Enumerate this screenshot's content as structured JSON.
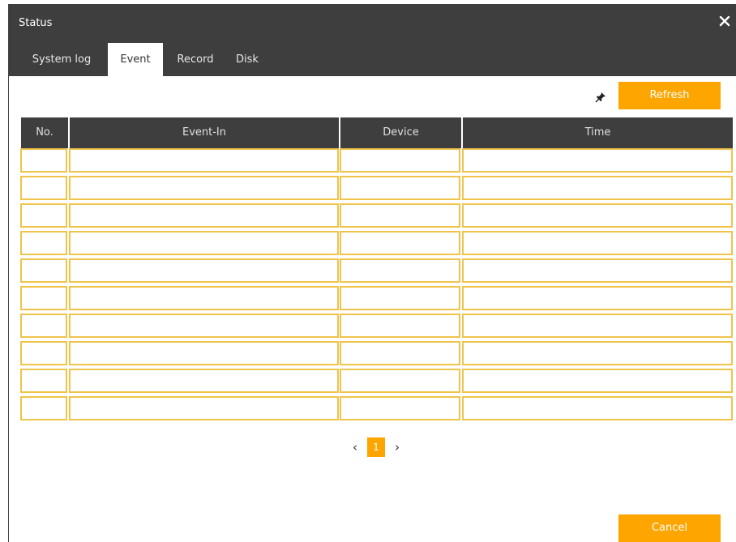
{
  "window": {
    "title": "Status",
    "close_icon": "close-icon"
  },
  "tabs": [
    {
      "label": "System log",
      "active": false
    },
    {
      "label": "Event",
      "active": true
    },
    {
      "label": "Record",
      "active": false
    },
    {
      "label": "Disk",
      "active": false
    }
  ],
  "toolbar": {
    "pin_icon": "pin-icon",
    "refresh_label": "Refresh"
  },
  "table": {
    "columns": [
      "No.",
      "Event-In",
      "Device",
      "Time"
    ],
    "rows": [
      [
        "",
        "",
        "",
        ""
      ],
      [
        "",
        "",
        "",
        ""
      ],
      [
        "",
        "",
        "",
        ""
      ],
      [
        "",
        "",
        "",
        ""
      ],
      [
        "",
        "",
        "",
        ""
      ],
      [
        "",
        "",
        "",
        ""
      ],
      [
        "",
        "",
        "",
        ""
      ],
      [
        "",
        "",
        "",
        ""
      ],
      [
        "",
        "",
        "",
        ""
      ],
      [
        "",
        "",
        "",
        ""
      ]
    ]
  },
  "pagination": {
    "prev": "‹",
    "current": "1",
    "next": "›"
  },
  "footer": {
    "cancel_label": "Cancel"
  },
  "colors": {
    "accent": "#ffa500",
    "header_bg": "#3e3e3e",
    "cell_border": "#f0c34a"
  }
}
